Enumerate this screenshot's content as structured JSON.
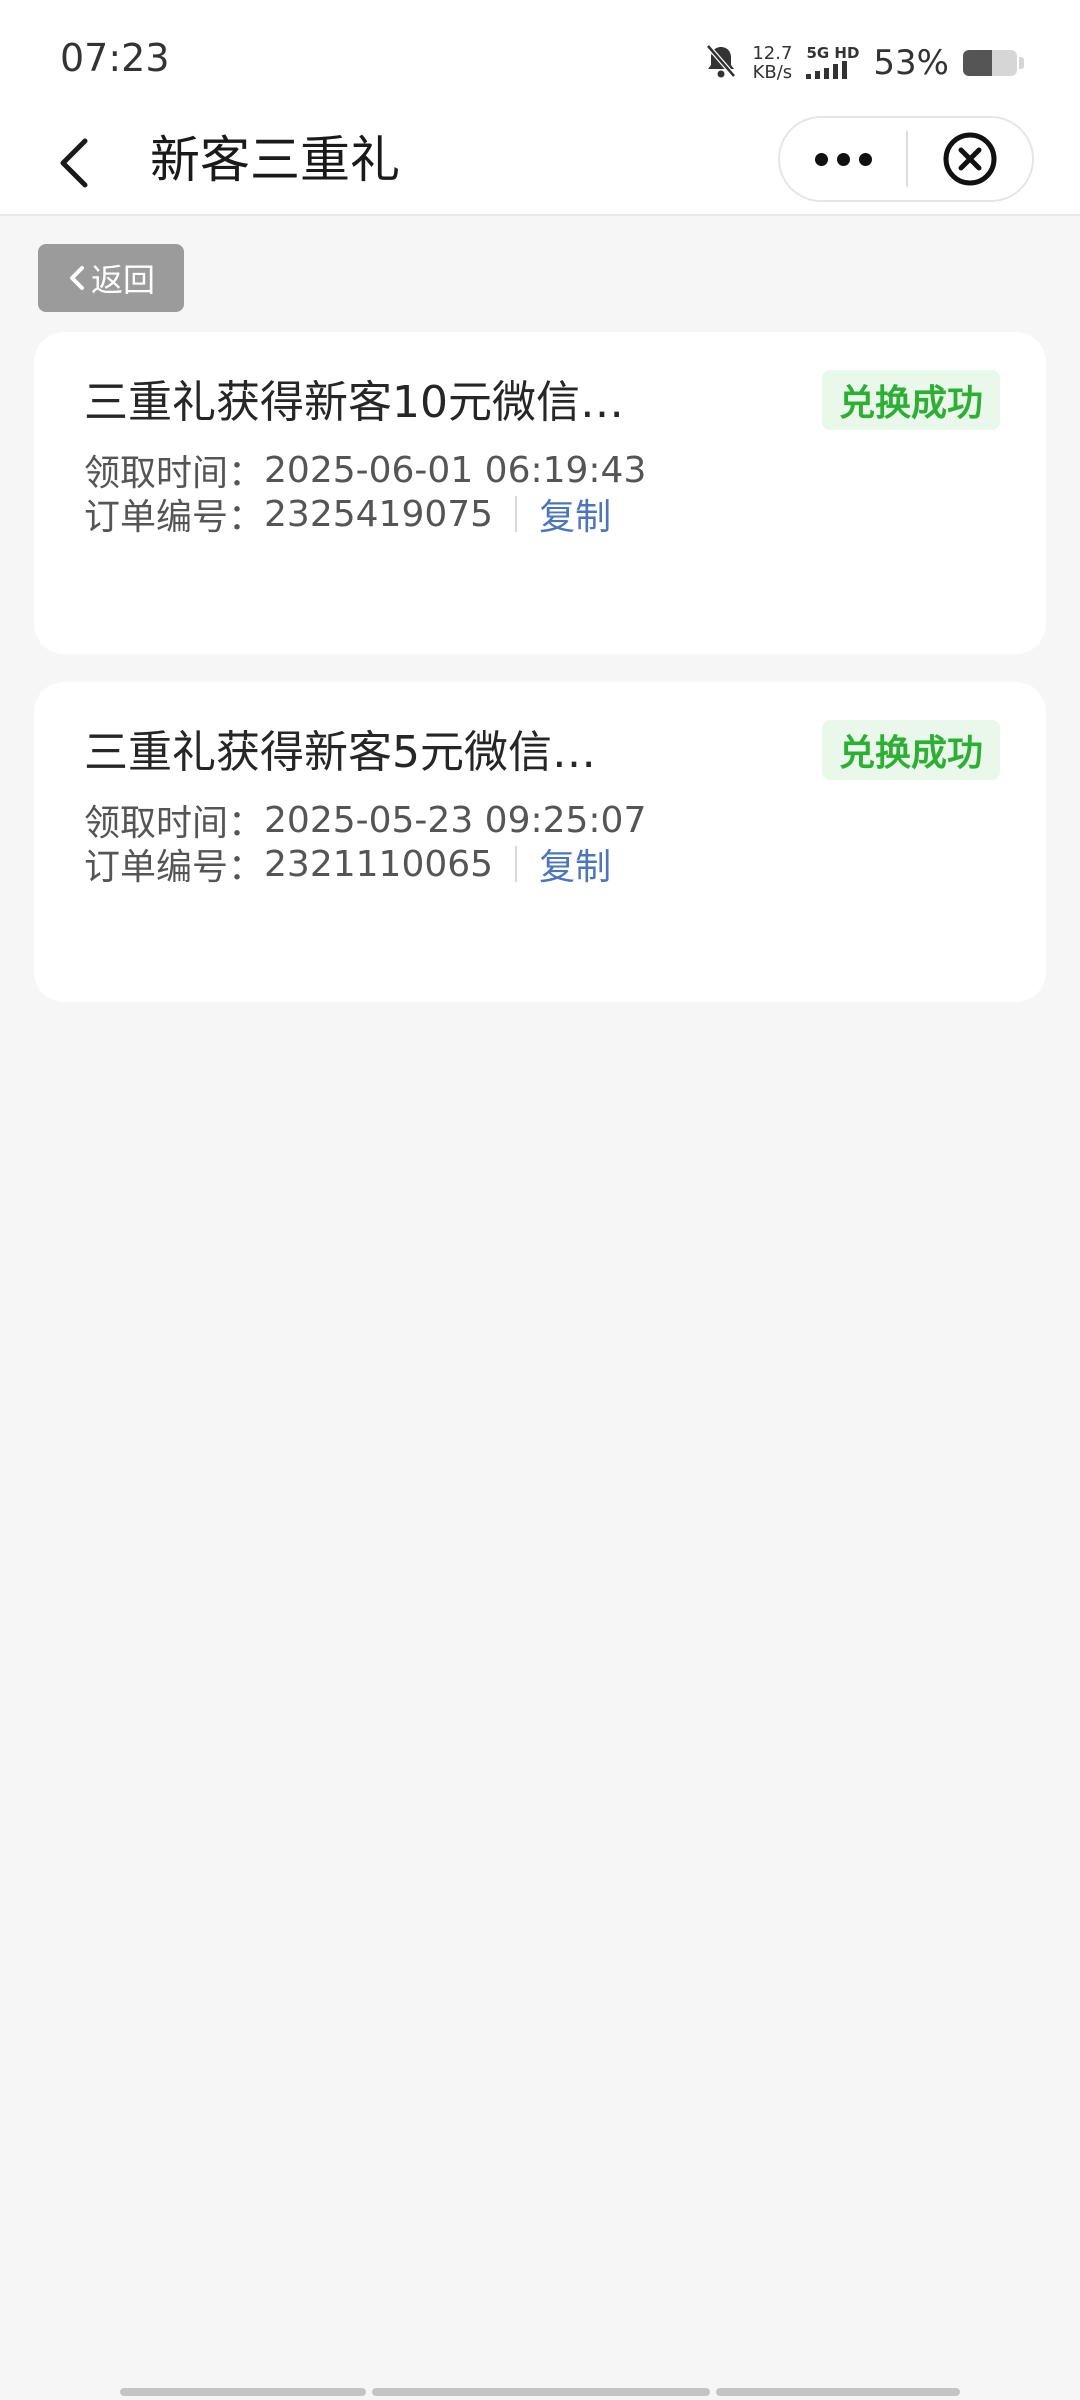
{
  "status_bar": {
    "time": "07:23",
    "speed_value": "12.7",
    "speed_unit": "KB/s",
    "network_type": "5G HD",
    "battery_percent": "53%",
    "battery_level": 0.53
  },
  "nav": {
    "title": "新客三重礼"
  },
  "back_button": {
    "label": "返回"
  },
  "records": [
    {
      "title": "三重礼获得新客10元微信…",
      "status": "兑换成功",
      "time_label": "领取时间：",
      "time_value": "2025-06-01 06:19:43",
      "order_label": "订单编号：",
      "order_value": "2325419075",
      "copy_label": "复制"
    },
    {
      "title": "三重礼获得新客5元微信…",
      "status": "兑换成功",
      "time_label": "领取时间：",
      "time_value": "2025-05-23 09:25:07",
      "order_label": "订单编号：",
      "order_value": "2321110065",
      "copy_label": "复制"
    }
  ],
  "colors": {
    "success_text": "#2fae35",
    "success_bg": "#e9f8ea",
    "link": "#4e75b5",
    "page_bg": "#f6f6f6"
  }
}
